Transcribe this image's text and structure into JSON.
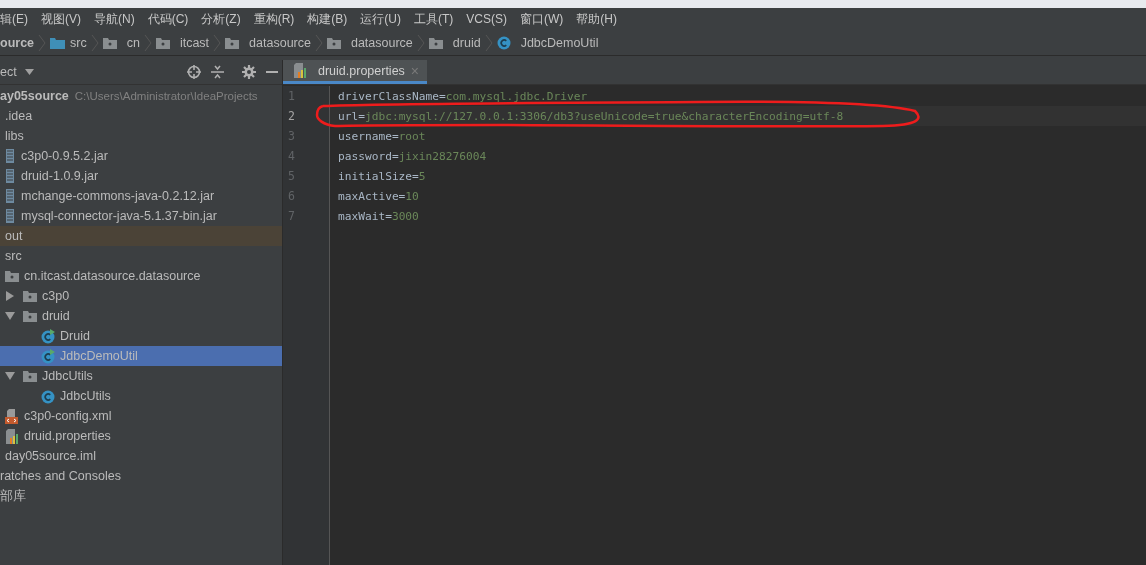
{
  "menu": [
    "辑(E)",
    "视图(V)",
    "导航(N)",
    "代码(C)",
    "分析(Z)",
    "重构(R)",
    "构建(B)",
    "运行(U)",
    "工具(T)",
    "VCS(S)",
    "窗口(W)",
    "帮助(H)"
  ],
  "breadcrumb": [
    {
      "label": "ource",
      "kind": "module"
    },
    {
      "label": "src",
      "kind": "source-folder"
    },
    {
      "label": "cn",
      "kind": "package"
    },
    {
      "label": "itcast",
      "kind": "package"
    },
    {
      "label": "datasource",
      "kind": "package"
    },
    {
      "label": "datasource",
      "kind": "package"
    },
    {
      "label": "druid",
      "kind": "package"
    },
    {
      "label": "JdbcDemoUtil",
      "kind": "class"
    }
  ],
  "project_panel": {
    "title": "ect",
    "tree": [
      {
        "label": "ay05source",
        "path": "C:\\Users\\Administrator\\IdeaProjects",
        "selected": false,
        "excluded": false,
        "children": [
          {
            "label": ".idea",
            "selected": false,
            "excluded": false
          },
          {
            "label": "libs",
            "selected": false,
            "excluded": false,
            "children": [
              {
                "label": "c3p0-0.9.5.2.jar",
                "kind": "jar",
                "selected": false,
                "excluded": false
              },
              {
                "label": "druid-1.0.9.jar",
                "kind": "jar",
                "selected": false,
                "excluded": false
              },
              {
                "label": "mchange-commons-java-0.2.12.jar",
                "kind": "jar",
                "selected": false,
                "excluded": false
              },
              {
                "label": "mysql-connector-java-5.1.37-bin.jar",
                "kind": "jar",
                "selected": false,
                "excluded": false
              }
            ]
          },
          {
            "label": "out",
            "selected": false,
            "excluded": true
          },
          {
            "label": "src",
            "selected": false,
            "excluded": false,
            "children": [
              {
                "label": "cn.itcast.datasource.datasource",
                "kind": "package",
                "selected": false,
                "excluded": false,
                "children": [
                  {
                    "label": "c3p0",
                    "kind": "package",
                    "expanded": false,
                    "selected": false,
                    "excluded": false
                  },
                  {
                    "label": "druid",
                    "kind": "package",
                    "expanded": true,
                    "selected": false,
                    "excluded": false,
                    "children": [
                      {
                        "label": "Druid",
                        "kind": "runnable-class",
                        "selected": false,
                        "excluded": false
                      },
                      {
                        "label": "JdbcDemoUtil",
                        "kind": "runnable-class",
                        "selected": true,
                        "excluded": false
                      }
                    ]
                  },
                  {
                    "label": "JdbcUtils",
                    "kind": "package",
                    "expanded": true,
                    "selected": false,
                    "excluded": false,
                    "children": [
                      {
                        "label": "JdbcUtils",
                        "kind": "class",
                        "selected": false,
                        "excluded": false
                      }
                    ]
                  }
                ]
              },
              {
                "label": "c3p0-config.xml",
                "kind": "xml",
                "selected": false,
                "excluded": false
              },
              {
                "label": "druid.properties",
                "kind": "properties",
                "selected": false,
                "excluded": false
              }
            ]
          },
          {
            "label": "day05source.iml",
            "selected": false,
            "excluded": false
          }
        ]
      },
      {
        "label": "ratches and Consoles",
        "selected": false,
        "excluded": false
      },
      {
        "label": "部库",
        "selected": false,
        "excluded": false
      }
    ]
  },
  "editor": {
    "tab": {
      "label": "druid.properties",
      "close": "×"
    },
    "lines": [
      {
        "number": "1",
        "key": "driverClassName=",
        "value": "com.mysql.jdbc.Driver",
        "current": false
      },
      {
        "number": "2",
        "key": "url=",
        "value": "jdbc:mysql://127.0.0.1:3306/db3?useUnicode=true&characterEncoding=utf-8",
        "current": true
      },
      {
        "number": "3",
        "key": "username=",
        "value": "root",
        "current": false
      },
      {
        "number": "4",
        "key": "password=",
        "value": "jixin28276004",
        "current": false
      },
      {
        "number": "5",
        "key": "initialSize=",
        "value": "5",
        "current": false
      },
      {
        "number": "6",
        "key": "maxActive=",
        "value": "10",
        "current": false
      },
      {
        "number": "7",
        "key": "maxWait=",
        "value": "3000",
        "current": false
      }
    ]
  }
}
